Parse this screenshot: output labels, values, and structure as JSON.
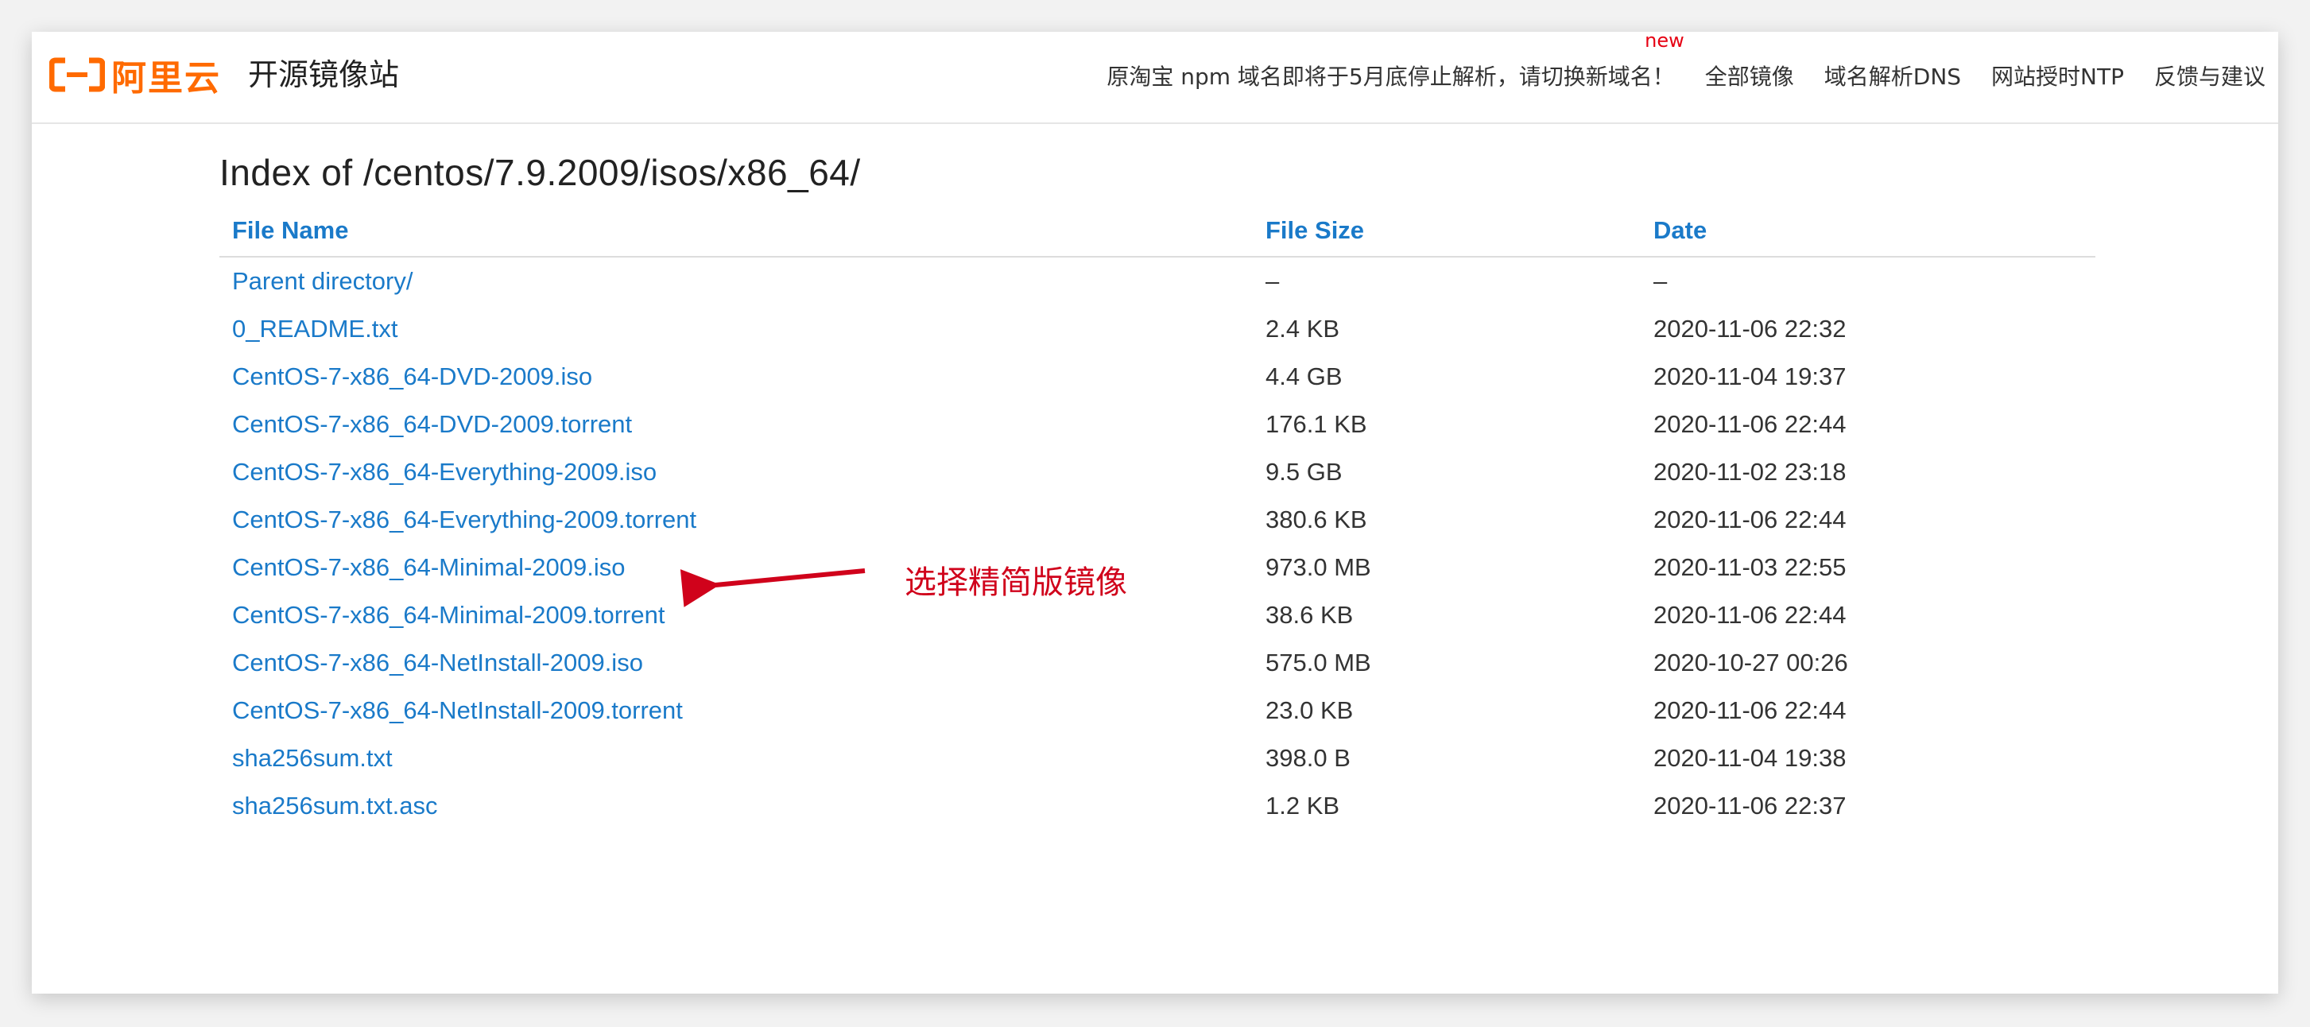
{
  "header": {
    "logo_text": "阿里云",
    "site_title": "开源镜像站",
    "notice": "原淘宝 npm 域名即将于5月底停止解析，请切换新域名！",
    "new_badge": "new",
    "links": [
      "全部镜像",
      "域名解析DNS",
      "网站授时NTP",
      "反馈与建议"
    ],
    "brand_color": "#ff6a00"
  },
  "main": {
    "title": "Index of /centos/7.9.2009/isos/x86_64/",
    "columns": [
      "File Name",
      "File Size",
      "Date"
    ],
    "rows": [
      {
        "name": "Parent directory/",
        "size": "–",
        "date": "–"
      },
      {
        "name": "0_README.txt",
        "size": "2.4 KB",
        "date": "2020-11-06 22:32"
      },
      {
        "name": "CentOS-7-x86_64-DVD-2009.iso",
        "size": "4.4 GB",
        "date": "2020-11-04 19:37"
      },
      {
        "name": "CentOS-7-x86_64-DVD-2009.torrent",
        "size": "176.1 KB",
        "date": "2020-11-06 22:44"
      },
      {
        "name": "CentOS-7-x86_64-Everything-2009.iso",
        "size": "9.5 GB",
        "date": "2020-11-02 23:18"
      },
      {
        "name": "CentOS-7-x86_64-Everything-2009.torrent",
        "size": "380.6 KB",
        "date": "2020-11-06 22:44"
      },
      {
        "name": "CentOS-7-x86_64-Minimal-2009.iso",
        "size": "973.0 MB",
        "date": "2020-11-03 22:55"
      },
      {
        "name": "CentOS-7-x86_64-Minimal-2009.torrent",
        "size": "38.6 KB",
        "date": "2020-11-06 22:44"
      },
      {
        "name": "CentOS-7-x86_64-NetInstall-2009.iso",
        "size": "575.0 MB",
        "date": "2020-10-27 00:26"
      },
      {
        "name": "CentOS-7-x86_64-NetInstall-2009.torrent",
        "size": "23.0 KB",
        "date": "2020-11-06 22:44"
      },
      {
        "name": "sha256sum.txt",
        "size": "398.0 B",
        "date": "2020-11-04 19:38"
      },
      {
        "name": "sha256sum.txt.asc",
        "size": "1.2 KB",
        "date": "2020-11-06 22:37"
      }
    ],
    "link_color": "#1a7ac9"
  },
  "annotation": {
    "label": "选择精简版镜像",
    "color": "#d0021b"
  }
}
